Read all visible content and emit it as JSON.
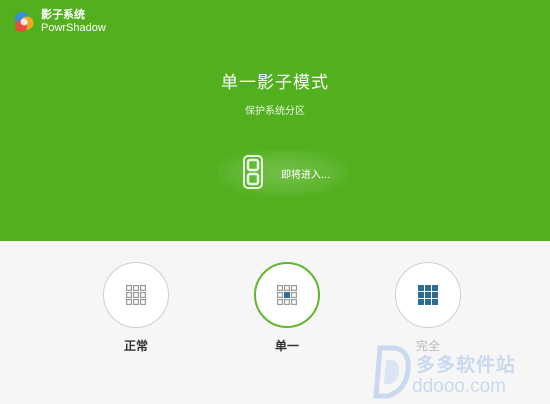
{
  "app": {
    "name_cn": "影子系统",
    "name_en": "PowrShadow"
  },
  "header": {
    "mode_title": "单一影子模式",
    "mode_subtitle": "保护系统分区"
  },
  "countdown": {
    "digit": "8",
    "entering_text": "即将进入..."
  },
  "modes": [
    {
      "label": "正常",
      "icon": "grid-empty-icon",
      "active": false
    },
    {
      "label": "单一",
      "icon": "grid-center-icon",
      "active": true
    },
    {
      "label": "完全",
      "icon": "grid-full-icon",
      "active": false
    }
  ],
  "watermark": {
    "cn": "多多软件站",
    "en": "ddooo.com"
  },
  "colors": {
    "brand_green": "#52b01e",
    "active_ring": "#61b72d",
    "grid_cell": "#9a9a9a",
    "grid_fill": "#2e6b93"
  }
}
